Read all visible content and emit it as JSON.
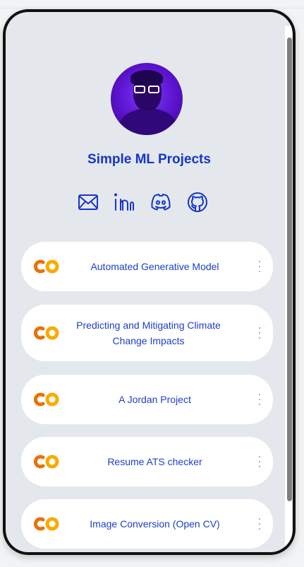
{
  "profile": {
    "title": "Simple ML Projects"
  },
  "socials": [
    {
      "icon": "mail-icon"
    },
    {
      "icon": "linkedin-icon"
    },
    {
      "icon": "discord-icon"
    },
    {
      "icon": "github-icon"
    }
  ],
  "links": [
    {
      "label": "Automated Generative Model",
      "icon": "colab-icon"
    },
    {
      "label": "Predicting and Mitigating Climate Change Impacts",
      "icon": "colab-icon"
    },
    {
      "label": "A Jordan Project",
      "icon": "colab-icon"
    },
    {
      "label": "Resume ATS checker",
      "icon": "colab-icon"
    },
    {
      "label": "Image Conversion (Open CV)",
      "icon": "colab-icon"
    }
  ],
  "colors": {
    "accent": "#1436c8",
    "card": "#ffffff",
    "background": "#e4e8ed",
    "colab_orange": "#f9ab00",
    "colab_dark_orange": "#e8710a"
  }
}
